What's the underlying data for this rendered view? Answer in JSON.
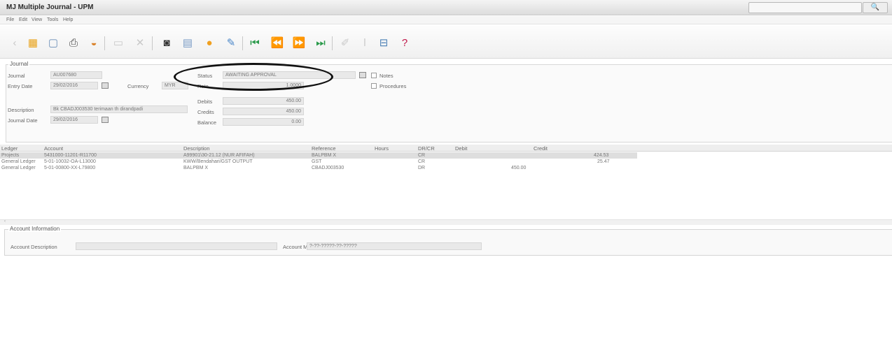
{
  "window": {
    "title": "MJ Multiple Journal - UPM",
    "search_icon": "magnifier-icon",
    "search_glyph": "🔍"
  },
  "menu": [
    "File",
    "Edit",
    "View",
    "Tools",
    "Help"
  ],
  "toolbar": {
    "buttons": [
      {
        "icon": "back-icon",
        "glyph": "‹",
        "color": "#c8c8c8"
      },
      {
        "icon": "new-icon",
        "glyph": "▦",
        "color": "#e8a21a"
      },
      {
        "icon": "open-icon",
        "glyph": "▢",
        "color": "#6c8fb8"
      },
      {
        "icon": "print-icon",
        "glyph": "⎙",
        "color": "#444444"
      },
      {
        "icon": "preview-icon",
        "glyph": "◒",
        "color": "#d9822b"
      },
      {
        "icon": "save-icon",
        "glyph": "▭",
        "color": "#c9c9c9"
      },
      {
        "icon": "delete-icon",
        "glyph": "✕",
        "color": "#c9c9c9"
      },
      {
        "icon": "find-icon",
        "glyph": "◙",
        "color": "#333333"
      },
      {
        "icon": "calendar-icon",
        "glyph": "▤",
        "color": "#7a9cc6"
      },
      {
        "icon": "info-icon",
        "glyph": "●",
        "color": "#f0a020"
      },
      {
        "icon": "attach-icon",
        "glyph": "✎",
        "color": "#4a86c8"
      },
      {
        "icon": "first-record-icon",
        "glyph": "⏮",
        "color": "#2a9a4a"
      },
      {
        "icon": "previous-record-icon",
        "glyph": "⏪",
        "color": "#2a9a4a"
      },
      {
        "icon": "next-record-icon",
        "glyph": "⏩",
        "color": "#2a9a4a"
      },
      {
        "icon": "last-record-icon",
        "glyph": "⏭",
        "color": "#2a9a4a"
      },
      {
        "icon": "edit-icon",
        "glyph": "✐",
        "color": "#c9c9c9"
      },
      {
        "icon": "post-icon",
        "glyph": "ǀ",
        "color": "#c9c9c9"
      },
      {
        "icon": "filter-icon",
        "glyph": "⊟",
        "color": "#4a7fb5"
      },
      {
        "icon": "help-icon",
        "glyph": "?",
        "color": "#c0184a"
      }
    ]
  },
  "journal": {
    "group_label": "Journal",
    "journal_label": "Journal",
    "journal_value": "AU007680",
    "entry_date_label": "Entry Date",
    "entry_date_value": "29/02/2016",
    "currency_label": "Currency",
    "currency_value": "MYR",
    "description_label": "Description",
    "description_value": "Bk CBADJ003530 terimaan th dirandpadi",
    "journal_date_label": "Journal Date",
    "journal_date_value": "29/02/2016",
    "status_label": "Status",
    "status_value": "AWAITING APPROVAL",
    "rate_label": "Rate",
    "rate_value": "1.0000",
    "debits_label": "Debits",
    "debits_value": "450.00",
    "credits_label": "Credits",
    "credits_value": "450.00",
    "balance_label": "Balance",
    "balance_value": "0.00",
    "notes_label": "Notes",
    "procedures_label": "Procedures"
  },
  "grid": {
    "columns": [
      "Ledger",
      "Account",
      "Description",
      "Reference",
      "Hours",
      "DR/CR",
      "Debit",
      "Credit"
    ],
    "rows": [
      {
        "ledger": "Projects",
        "account": "5431000-11201-R11700",
        "description": "A99901\\30-21.12 (NUR AFIFAH)",
        "reference": "BALPBM X",
        "hours": "",
        "drcr": "CR",
        "debit": "",
        "credit": "424.53",
        "selected": true
      },
      {
        "ledger": "General Ledger",
        "account": "5-01-10032-OA-L13000",
        "description": "KWW/Bendahari/GST OUTPUT",
        "reference": "GST",
        "hours": "",
        "drcr": "CR",
        "debit": "",
        "credit": "25.47",
        "selected": false
      },
      {
        "ledger": "General Ledger",
        "account": "5-01-00800-XX-L79800",
        "description": "BALPBM X",
        "reference": "CBADJ003530",
        "hours": "",
        "drcr": "DR",
        "debit": "450.00",
        "credit": "",
        "selected": false
      }
    ]
  },
  "account_info": {
    "group_label": "Account Information",
    "description_label": "Account Description",
    "description_value": "",
    "mask_label": "Account Mask",
    "mask_value": "?-??-?????-??-?????"
  }
}
